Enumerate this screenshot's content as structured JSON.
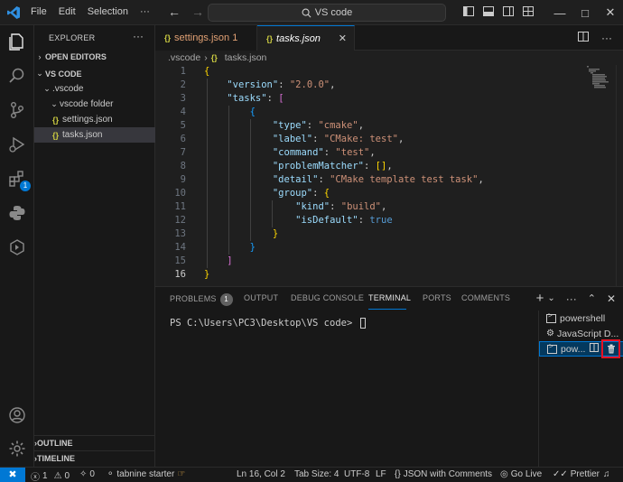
{
  "titlebar": {
    "menu": [
      "File",
      "Edit",
      "Selection",
      "···"
    ],
    "search_text": "VS code",
    "search_icon": "search-icon",
    "back": "←",
    "forward": "→"
  },
  "sidebar": {
    "title": "EXPLORER",
    "more": "···",
    "open_editors": "OPEN EDITORS",
    "workspace": "VS CODE",
    "folder1": ".vscode",
    "folder2": "vscode folder",
    "file1": "settings.json",
    "file2": "tasks.json",
    "outline": "OUTLINE",
    "timeline": "TIMELINE",
    "extensions_badge": "1"
  },
  "tabs": {
    "tab1": "settings.json 1",
    "tab2": "tasks.json",
    "json_icon": "{}",
    "close": "✕"
  },
  "breadcrumb": {
    "part1": ".vscode",
    "sep": "›",
    "part2": "tasks.json"
  },
  "editor": {
    "line_numbers": [
      "1",
      "2",
      "3",
      "4",
      "5",
      "6",
      "7",
      "8",
      "9",
      "10",
      "11",
      "12",
      "13",
      "14",
      "15",
      "16"
    ],
    "current_line": 16,
    "code": {
      "version_key": "\"version\"",
      "version_val": "\"2.0.0\"",
      "tasks_key": "\"tasks\"",
      "type_key": "\"type\"",
      "type_val": "\"cmake\"",
      "label_key": "\"label\"",
      "label_val": "\"CMake: test\"",
      "command_key": "\"command\"",
      "command_val": "\"test\"",
      "pm_key": "\"problemMatcher\"",
      "pm_val": "[]",
      "detail_key": "\"detail\"",
      "detail_val": "\"CMake template test task\"",
      "group_key": "\"group\"",
      "kind_key": "\"kind\"",
      "kind_val": "\"build\"",
      "isdefault_key": "\"isDefault\"",
      "isdefault_val": "true"
    }
  },
  "panel": {
    "tabs": [
      "PROBLEMS",
      "OUTPUT",
      "DEBUG CONSOLE",
      "TERMINAL",
      "PORTS",
      "COMMENTS"
    ],
    "problems_count": "1",
    "active_tab": "TERMINAL",
    "prompt": "PS C:\\Users\\PC3\\Desktop\\VS code> ",
    "terminals": [
      "powershell",
      "JavaScript D...",
      "pow..."
    ],
    "selected_terminal": 2
  },
  "statusbar": {
    "remote": "✖",
    "errors": "1",
    "warnings": "0",
    "ports": "0",
    "tabnine": "tabnine starter",
    "position": "Ln 16, Col 2",
    "tabsize": "Tab Size: 4",
    "encoding": "UTF-8",
    "eol": "LF",
    "language": "JSON with Comments",
    "golive": "Go Live",
    "prettier": "Prettier"
  },
  "colors": {
    "accent": "#0078d4",
    "highlight_box": "#e81123",
    "json_icon": "#cbcb41"
  }
}
